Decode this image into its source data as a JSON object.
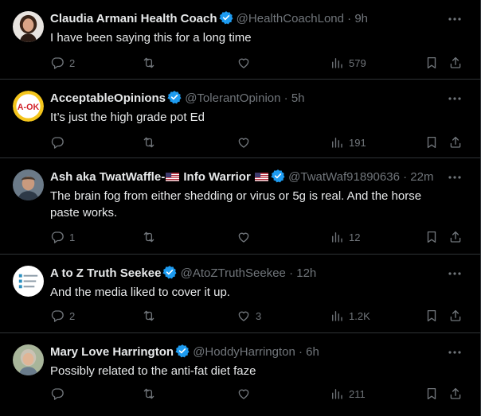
{
  "tweets": [
    {
      "name": "Claudia Armani Health Coach",
      "handle": "@HealthCoachLond",
      "sep": "·",
      "time": "9h",
      "text": "I have been saying this for a long time",
      "replies": "2",
      "retweets": "",
      "likes": "",
      "views": "579",
      "avatar": "woman-portrait"
    },
    {
      "name": "AcceptableOpinions",
      "handle": "@TolerantOpinion",
      "sep": "·",
      "time": "5h",
      "text": "It’s just the high grade pot Ed",
      "replies": "",
      "retweets": "",
      "likes": "",
      "views": "191",
      "avatar": "a-ok-logo",
      "avatar_text": "A-OK"
    },
    {
      "name_prefix": "Ash aka TwatWaffle-",
      "name_suffix": " Info Warrior",
      "handle": "@TwatWaf91890636",
      "sep": "·",
      "time": "22m",
      "text": "The brain fog from either shedding or virus or 5g is real. And the horse paste works.",
      "replies": "1",
      "retweets": "",
      "likes": "",
      "views": "12",
      "avatar": "man-portrait"
    },
    {
      "name": "A to Z Truth Seekee",
      "handle": "@AtoZTruthSeekee",
      "sep": "·",
      "time": "12h",
      "text": "And the media liked to cover it up.",
      "replies": "2",
      "retweets": "",
      "likes": "3",
      "views": "1.2K",
      "avatar": "chart-legend-image"
    },
    {
      "name": "Mary Love Harrington",
      "handle": "@HoddyHarrington",
      "sep": "·",
      "time": "6h",
      "text": "Possibly related to the anti-fat diet faze",
      "replies": "",
      "retweets": "",
      "likes": "",
      "views": "211",
      "avatar": "older-woman-portrait"
    }
  ],
  "colors": {
    "background": "#000000",
    "text": "#e7e9ea",
    "muted": "#71767b",
    "divider": "#2f3336",
    "verified": "#1d9bf0"
  }
}
